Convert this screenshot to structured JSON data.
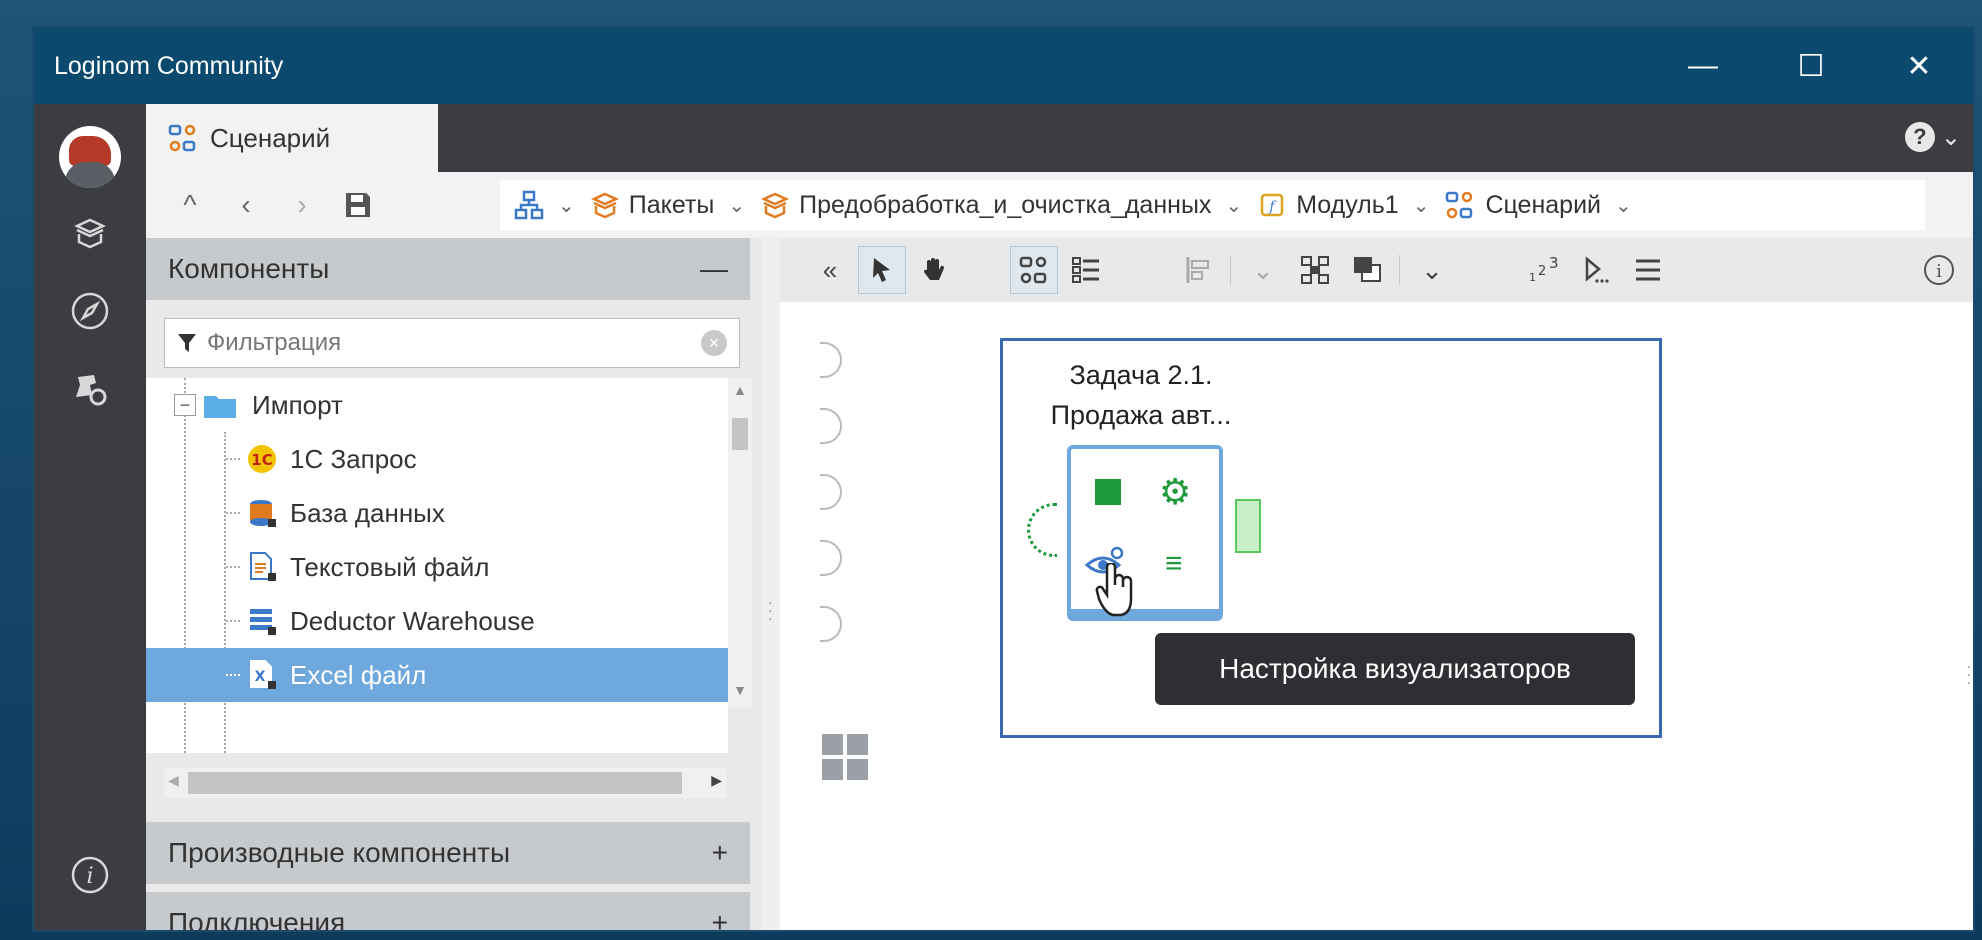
{
  "window": {
    "title": "Loginom Community",
    "controls": {
      "minimize": "—",
      "maximize": "☐",
      "close": "✕"
    }
  },
  "rail": {
    "icons": [
      "avatar",
      "packages-icon",
      "compass-icon",
      "user-settings-icon",
      "info-icon"
    ]
  },
  "tabs": [
    {
      "label": "Сценарий",
      "icon": "scenario-icon"
    }
  ],
  "help": {
    "label": "?"
  },
  "breadcrumbs": [
    {
      "label": "Пакеты",
      "icon": "package-icon"
    },
    {
      "label": "Предобработка_и_очистка_данных",
      "icon": "package-icon"
    },
    {
      "label": "Модуль1",
      "icon": "module-icon"
    },
    {
      "label": "Сценарий",
      "icon": "scenario-icon"
    }
  ],
  "components_panel": {
    "title": "Компоненты",
    "collapse": "—",
    "filter_placeholder": "Фильтрация",
    "tree": {
      "group": "Импорт",
      "items": [
        "1С Запрос",
        "База данных",
        "Текстовый файл",
        "Deductor Warehouse",
        "Excel файл"
      ],
      "selected_index": 4
    }
  },
  "derived_panel": {
    "title": "Производные компоненты",
    "expand": "+"
  },
  "connections_panel": {
    "title": "Подключения",
    "expand": "+"
  },
  "node": {
    "title_line1": "Задача 2.1.",
    "title_line2": "Продажа авт..."
  },
  "tooltip": {
    "text": "Настройка визуализаторов"
  },
  "colors": {
    "titlebar": "#0b4a6e",
    "rail": "#3b3d42",
    "selection": "#6fa8dc",
    "node_border": "#3c68b0",
    "green": "#1e9a3a"
  }
}
